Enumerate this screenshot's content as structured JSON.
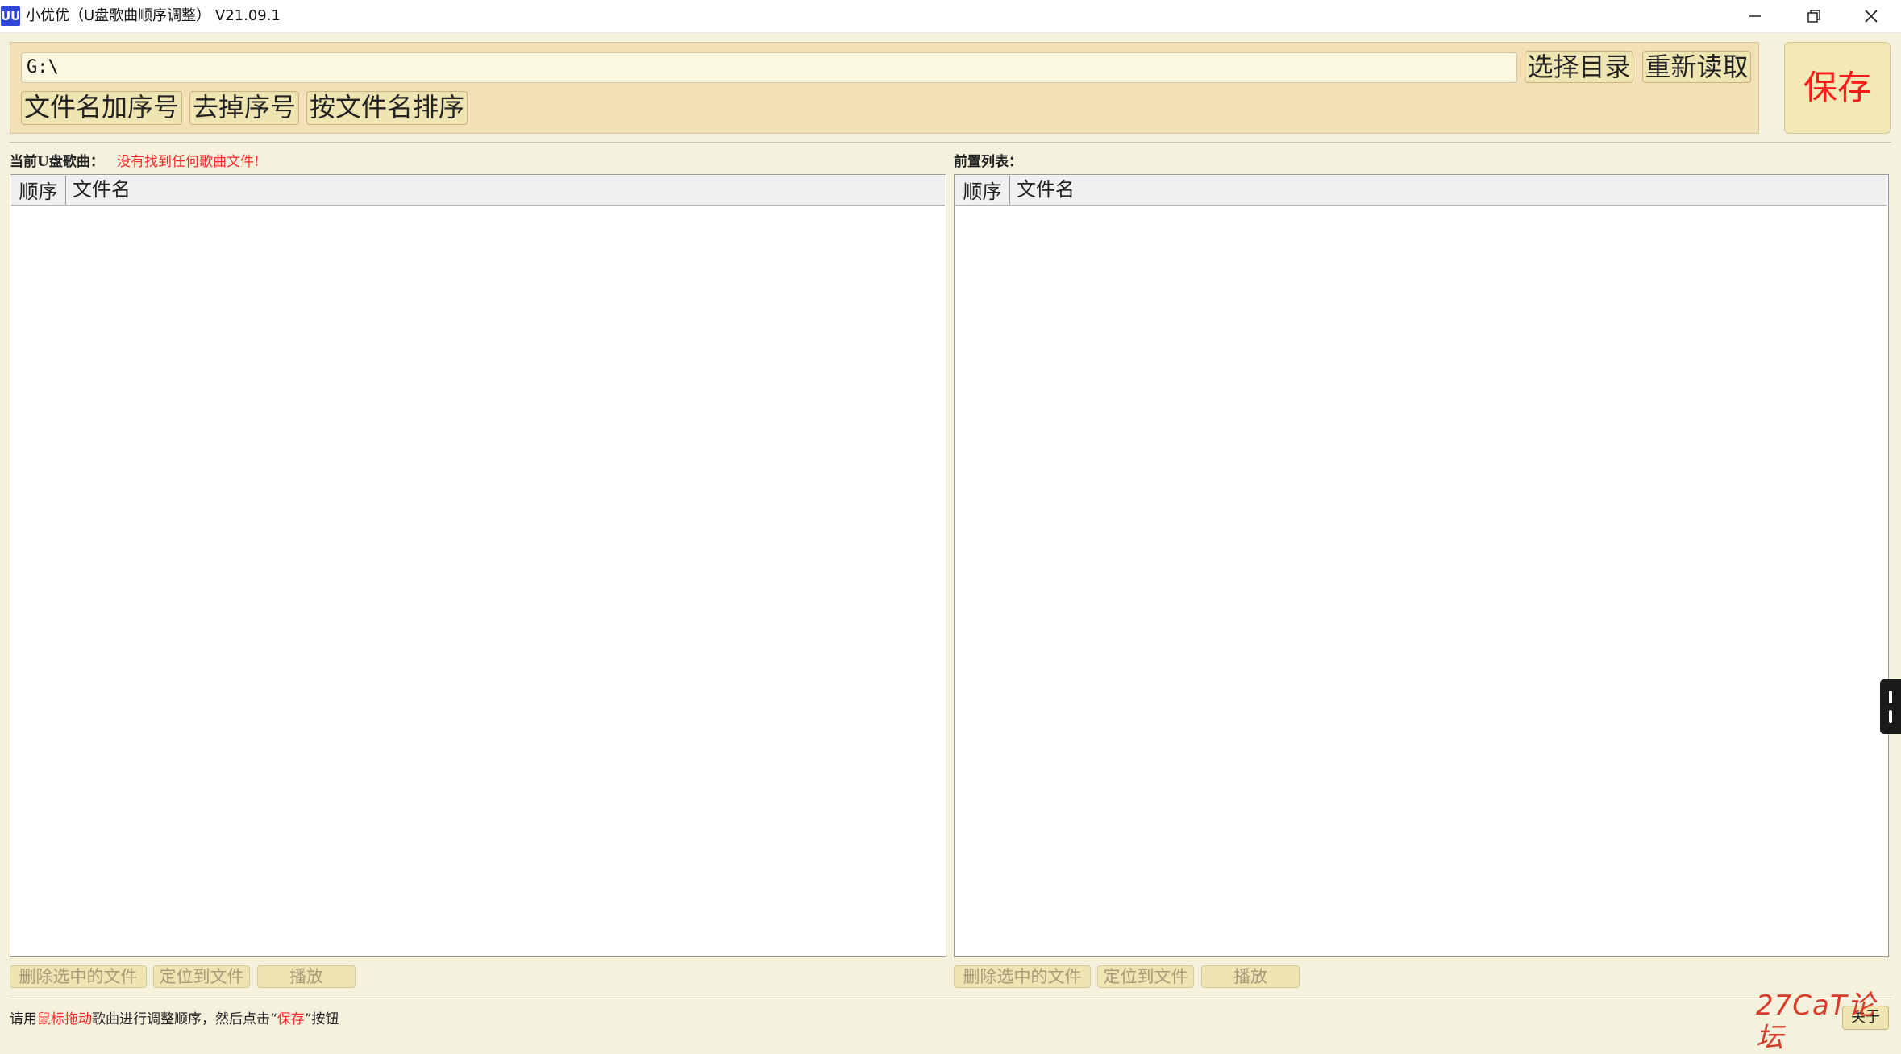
{
  "window": {
    "app_icon_text": "UU",
    "title": "小优优（U盘歌曲顺序调整） V21.09.1"
  },
  "toolbar": {
    "path_value": "G:\\",
    "choose_dir": "选择目录",
    "reload": "重新读取",
    "add_index": "文件名加序号",
    "remove_index": "去掉序号",
    "sort_by_name": "按文件名排序",
    "save": "保存"
  },
  "left_panel": {
    "label": "当前U盘歌曲：",
    "message": "没有找到任何歌曲文件!",
    "columns": [
      "顺序",
      "文件名"
    ],
    "rows": [],
    "buttons": {
      "delete": "删除选中的文件",
      "locate": "定位到文件",
      "play": "播放"
    }
  },
  "right_panel": {
    "label": "前置列表：",
    "columns": [
      "顺序",
      "文件名"
    ],
    "rows": [],
    "buttons": {
      "delete": "删除选中的文件",
      "locate": "定位到文件",
      "play": "播放"
    }
  },
  "status": {
    "part1": "请用",
    "highlight1": "鼠标拖动",
    "part2": "歌曲进行调整顺序，然后点击“",
    "highlight2": "保存",
    "part3": "”按钮"
  },
  "corner_button": "关于",
  "watermark": "27CaT论坛",
  "colors": {
    "accent_red": "#ff1a1a",
    "button_bg": "#efe5b2",
    "panel_bg": "#f4e0b6"
  }
}
